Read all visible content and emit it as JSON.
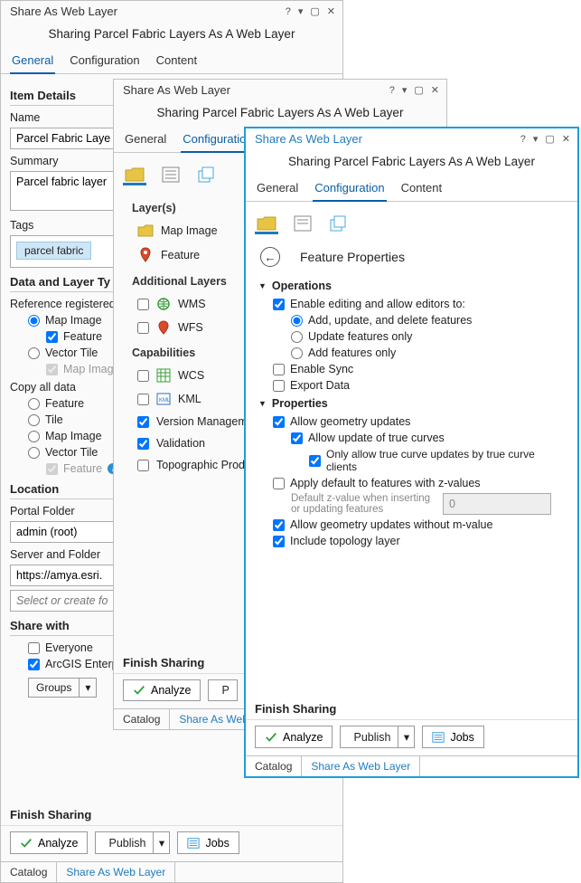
{
  "pane1": {
    "title": "Share As Web Layer",
    "subtitle": "Sharing Parcel Fabric Layers As A Web Layer",
    "tabs": {
      "general": "General",
      "configuration": "Configuration",
      "content": "Content"
    },
    "sections": {
      "item_details": "Item Details",
      "data_layer_type": "Data and Layer Ty",
      "location": "Location",
      "share_with": "Share with"
    },
    "item_details": {
      "name_label": "Name",
      "name_value": "Parcel Fabric Laye",
      "summary_label": "Summary",
      "summary_value": "Parcel fabric layer",
      "tags_label": "Tags",
      "tag_chip": "parcel fabric"
    },
    "data_layer": {
      "reference_label": "Reference registered",
      "map_image": "Map Image",
      "feature": "Feature",
      "vector_tile": "Vector Tile",
      "map_image_sub": "Map Image",
      "copy_label": "Copy all data",
      "tile": "Tile",
      "feature_sub": "Feature"
    },
    "location": {
      "portal_folder": "Portal Folder",
      "portal_value": "admin (root)",
      "server_folder": "Server and Folder",
      "server_value": "https://amya.esri.",
      "placeholder": "Select or create fo"
    },
    "share_with": {
      "everyone": "Everyone",
      "arcgis": "ArcGIS Enterprise",
      "groups": "Groups"
    },
    "finish": "Finish Sharing",
    "buttons": {
      "analyze": "Analyze",
      "publish": "Publish",
      "jobs": "Jobs"
    },
    "bottom": {
      "catalog": "Catalog",
      "share": "Share As Web Layer"
    }
  },
  "pane2": {
    "title": "Share As Web Layer",
    "subtitle": "Sharing Parcel Fabric Layers As A Web Layer",
    "tabs": {
      "general": "General",
      "configuration": "Configuratio",
      "content": "Content"
    },
    "layers_label": "Layer(s)",
    "layers": {
      "map_image": "Map Image",
      "feature": "Feature"
    },
    "additional_label": "Additional Layers",
    "additional": {
      "wms": "WMS",
      "wfs": "WFS"
    },
    "capabilities_label": "Capabilities",
    "capabilities": {
      "wcs": "WCS",
      "kml": "KML",
      "version": "Version Managem",
      "validation": "Validation",
      "topo": "Topographic Prod"
    },
    "finish": "Finish Sharing",
    "buttons": {
      "analyze": "Analyze",
      "publish": "P"
    },
    "bottom": {
      "catalog": "Catalog",
      "share": "Share As Web L"
    }
  },
  "pane3": {
    "title": "Share As Web Layer",
    "subtitle": "Sharing Parcel Fabric Layers As A Web Layer",
    "tabs": {
      "general": "General",
      "configuration": "Configuration",
      "content": "Content"
    },
    "panel_title": "Feature Properties",
    "operations": {
      "header": "Operations",
      "enable_editing": "Enable editing and allow editors to:",
      "add_update_delete": "Add, update, and delete features",
      "update_only": "Update features only",
      "add_only": "Add features only",
      "enable_sync": "Enable Sync",
      "export_data": "Export Data"
    },
    "properties": {
      "header": "Properties",
      "allow_geometry": "Allow geometry updates",
      "allow_true_curves": "Allow update of true curves",
      "only_true_curve": "Only allow true curve updates by true curve clients",
      "apply_default_z": "Apply default to features with z-values",
      "default_z_label": "Default z-value when inserting or updating features",
      "default_z_value": "0",
      "allow_without_m": "Allow geometry updates without m-value",
      "include_topology": "Include topology layer"
    },
    "finish": "Finish Sharing",
    "buttons": {
      "analyze": "Analyze",
      "publish": "Publish",
      "jobs": "Jobs"
    },
    "bottom": {
      "catalog": "Catalog",
      "share": "Share As Web Layer"
    }
  }
}
